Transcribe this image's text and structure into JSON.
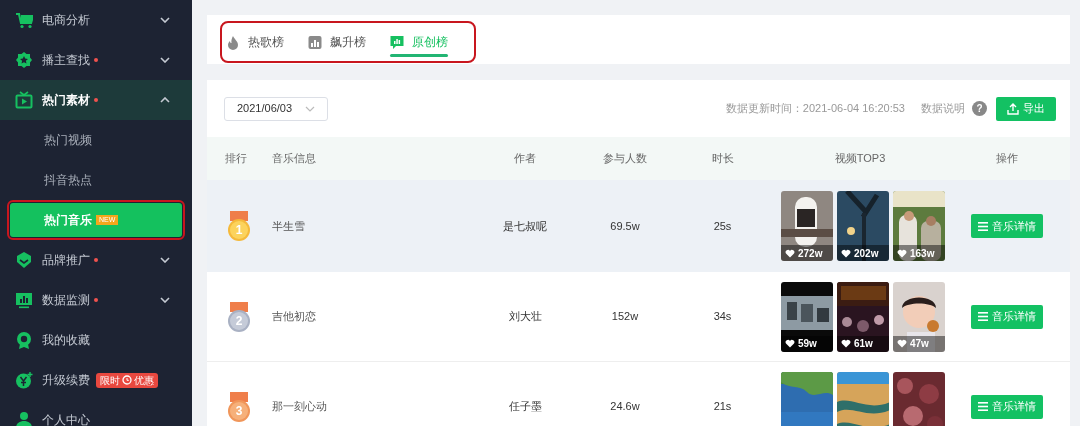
{
  "sidebar": {
    "items": [
      {
        "label": "电商分析",
        "kind": "group",
        "dot": false,
        "expanded": false
      },
      {
        "label": "播主查找",
        "kind": "group",
        "dot": true,
        "expanded": false
      },
      {
        "label": "热门素材",
        "kind": "group",
        "dot": true,
        "expanded": true,
        "children": [
          {
            "label": "热门视频",
            "selected": false,
            "highlight": false
          },
          {
            "label": "抖音热点",
            "selected": false,
            "highlight": false
          },
          {
            "label": "热门音乐",
            "selected": true,
            "highlight": true,
            "badge": "NEW"
          }
        ]
      },
      {
        "label": "品牌推广",
        "kind": "group",
        "dot": true,
        "expanded": false
      },
      {
        "label": "数据监测",
        "kind": "group",
        "dot": true,
        "expanded": false
      },
      {
        "label": "我的收藏",
        "kind": "link",
        "dot": false
      },
      {
        "label": "升级续费",
        "kind": "link",
        "dot": false,
        "promo": [
          "限时",
          "优惠"
        ]
      },
      {
        "label": "个人中心",
        "kind": "link",
        "dot": false
      }
    ]
  },
  "tabs": {
    "highlight": true,
    "items": [
      {
        "label": "热歌榜",
        "selected": false
      },
      {
        "label": "飙升榜",
        "selected": false
      },
      {
        "label": "原创榜",
        "selected": true
      }
    ]
  },
  "toolbar": {
    "date": "2021/06/03",
    "updated": "数据更新时间：2021-06-04 16:20:53",
    "help": "数据说明",
    "help_icon": "?",
    "export": "导出"
  },
  "table": {
    "columns": [
      "排行",
      "音乐信息",
      "作者",
      "参与人数",
      "时长",
      "视频TOP3",
      "操作"
    ],
    "rows": [
      {
        "rank": "1",
        "title": "半生雪",
        "author": "是七叔呢",
        "participants": "69.5w",
        "duration": "25s",
        "hovered": true,
        "videos": [
          {
            "likes": "272w"
          },
          {
            "likes": "202w"
          },
          {
            "likes": "163w"
          }
        ],
        "action": "音乐详情"
      },
      {
        "rank": "2",
        "title": "吉他初恋",
        "author": "刘大壮",
        "participants": "152w",
        "duration": "34s",
        "hovered": false,
        "videos": [
          {
            "likes": "59w"
          },
          {
            "likes": "61w"
          },
          {
            "likes": "47w"
          }
        ],
        "action": "音乐详情"
      },
      {
        "rank": "3",
        "title": "那一刻心动",
        "author": "任子墨",
        "participants": "24.6w",
        "duration": "21s",
        "hovered": false,
        "action": "音乐详情"
      }
    ]
  }
}
